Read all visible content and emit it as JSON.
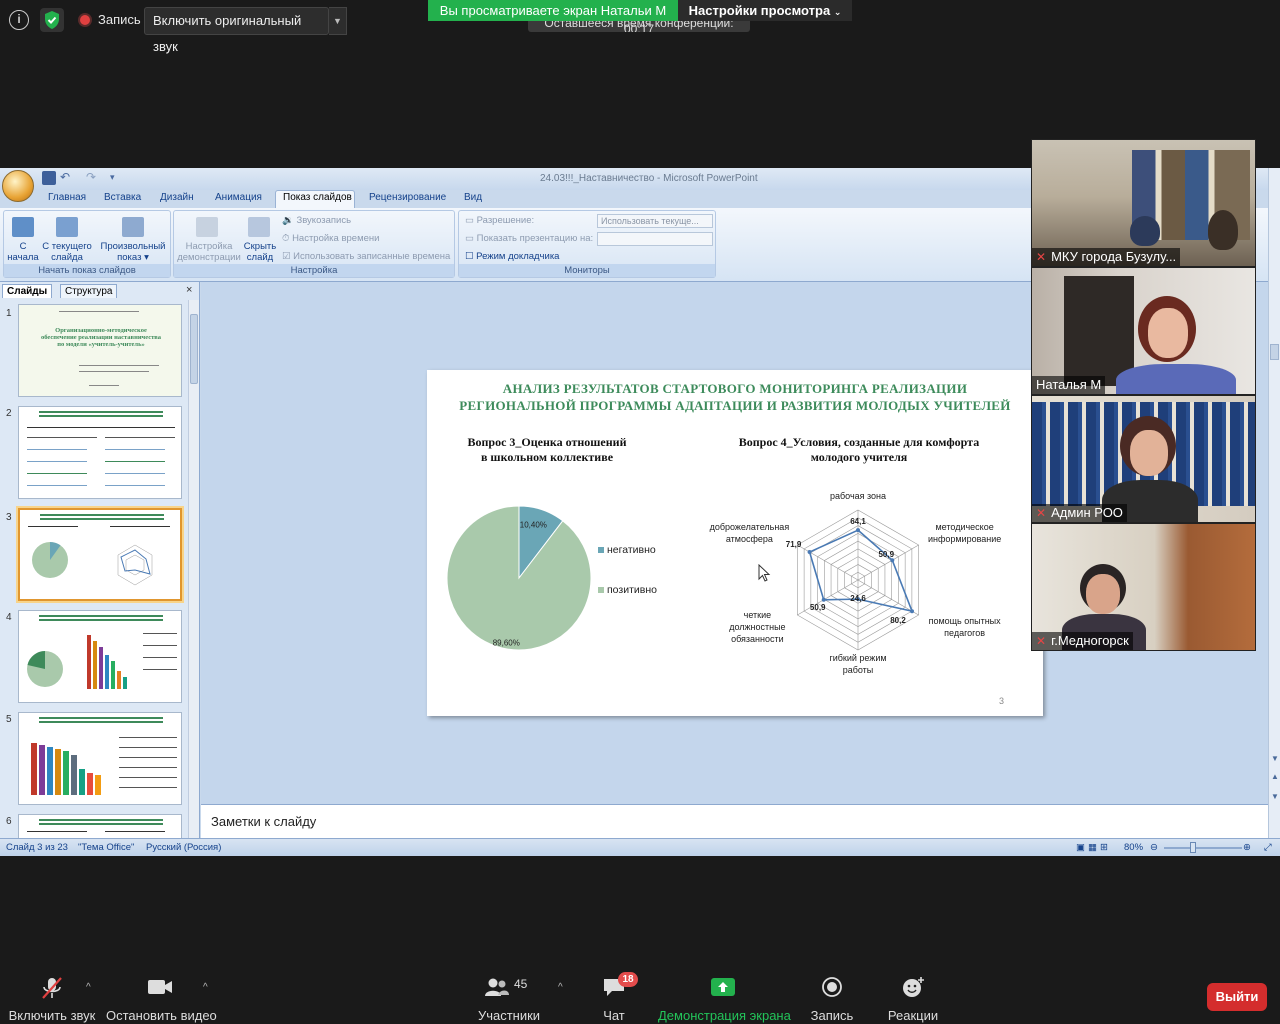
{
  "zoom_top": {
    "recording_label": "Запись",
    "original_sound_button": "Включить оригинальный звук",
    "viewing_banner": "Вы просматриваете экран Натальи М",
    "view_settings": "Настройки просмотра",
    "time_remaining": "Оставшееся время конференции: 00:17"
  },
  "ppt": {
    "window_title": "24.03!!!_Наставничество - Microsoft PowerPoint",
    "tabs": [
      "Главная",
      "Вставка",
      "Дизайн",
      "Анимация",
      "Показ слайдов",
      "Рецензирование",
      "Вид"
    ],
    "active_tab": "Показ слайдов",
    "ribbon": {
      "group1_label": "Начать показ слайдов",
      "from_start": [
        "С",
        "начала"
      ],
      "from_current": [
        "С текущего",
        "слайда"
      ],
      "custom_show": [
        "Произвольный",
        "показ ▾"
      ],
      "group2_label": "Настройка",
      "setup": [
        "Настройка",
        "демонстрации"
      ],
      "hide_slide": [
        "Скрыть",
        "слайд"
      ],
      "record_narration": "Звукозапись",
      "rehearse_timings": "Настройка времени",
      "use_timings": "Использовать записанные времена",
      "group3_label": "Мониторы",
      "resolution_label": "Разрешение:",
      "resolution_value": "Использовать текуще...",
      "show_on_label": "Показать презентацию на:",
      "presenter_view": "Режим докладчика"
    },
    "panel_tabs": [
      "Слайды",
      "Структура"
    ],
    "thumbnails": [
      "1",
      "2",
      "3",
      "4",
      "5",
      "6"
    ],
    "thumb1_title": "Организационно-методическое обеспечение реализации наставничества по модели «учитель-учитель»",
    "slide": {
      "title_line1": "АНАЛИЗ РЕЗУЛЬТАТОВ СТАРТОВОГО МОНИТОРИНГА РЕАЛИЗАЦИИ",
      "title_line2": "РЕГИОНАЛЬНОЙ ПРОГРАММЫ АДАПТАЦИИ И РАЗВИТИЯ МОЛОДЫХ УЧИТЕЛЕЙ",
      "number": "3"
    },
    "notes_placeholder": "Заметки к слайду",
    "status": {
      "slide_of": "Слайд 3 из 23",
      "theme": "\"Тема Office\"",
      "language": "Русский (Россия)",
      "zoom": "80%"
    }
  },
  "chart_data": [
    {
      "type": "pie",
      "title": "Вопрос 3_Оценка отношений в школьном коллективе",
      "title_lines": [
        "Вопрос 3_Оценка отношений",
        "в школьном коллективе"
      ],
      "categories": [
        "негативно",
        "позитивно"
      ],
      "values": [
        10.4,
        89.6
      ],
      "labels": [
        "10,40%",
        "89,60%"
      ],
      "colors": [
        "#6aa6b6",
        "#a9c9ab"
      ],
      "legend": "right"
    },
    {
      "type": "radar",
      "title": "Вопрос 4_Условия, созданные для комфорта молодого учителя",
      "title_lines": [
        "Вопрос 4_Условия, созданные для комфорта",
        "молодого учителя"
      ],
      "categories": [
        "рабочая зона",
        "методическое информирование",
        "помощь опытных педагогов",
        "гибкий режим работы",
        "четкие должностные обязанности",
        "доброжелательная атмосфера"
      ],
      "category_lines": [
        [
          "рабочая зона"
        ],
        [
          "методическое",
          "информирование"
        ],
        [
          "помощь опытных",
          "педагогов"
        ],
        [
          "гибкий режим",
          "работы"
        ],
        [
          "четкие",
          "должностные",
          "обязанности"
        ],
        [
          "доброжелательная",
          "атмосфера"
        ]
      ],
      "values": [
        64.1,
        50.9,
        80.2,
        24.6,
        50.9,
        71.9
      ],
      "value_labels": [
        "64,1",
        "50,9",
        "80,2",
        "24,6",
        "50,9",
        "71,9"
      ],
      "rmax": 90,
      "rings": 9,
      "color": "#4a7ab4"
    }
  ],
  "participants": [
    {
      "name": "МКУ города Бузулу...",
      "muted": true
    },
    {
      "name": "Наталья М",
      "muted": false
    },
    {
      "name": "Админ РОО",
      "muted": true
    },
    {
      "name": "г.Медногорск",
      "muted": true
    }
  ],
  "toolbar": {
    "unmute": "Включить звук",
    "stop_video": "Остановить видео",
    "participants": "Участники",
    "participants_count": "45",
    "chat": "Чат",
    "chat_badge": "18",
    "share_screen": "Демонстрация экрана",
    "record": "Запись",
    "reactions": "Реакции",
    "leave": "Выйти"
  }
}
